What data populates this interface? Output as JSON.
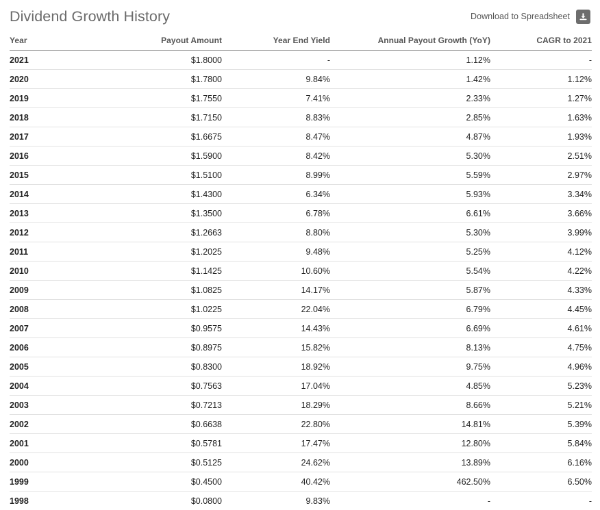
{
  "header": {
    "title": "Dividend Growth History",
    "download_label": "Download to Spreadsheet",
    "download_icon": "download-icon"
  },
  "table": {
    "columns": [
      "Year",
      "Payout Amount",
      "Year End Yield",
      "Annual Payout Growth (YoY)",
      "CAGR to 2021"
    ],
    "rows": [
      {
        "year": "2021",
        "payout": "$1.8000",
        "yield": "-",
        "growth": "1.12%",
        "cagr": "-"
      },
      {
        "year": "2020",
        "payout": "$1.7800",
        "yield": "9.84%",
        "growth": "1.42%",
        "cagr": "1.12%"
      },
      {
        "year": "2019",
        "payout": "$1.7550",
        "yield": "7.41%",
        "growth": "2.33%",
        "cagr": "1.27%"
      },
      {
        "year": "2018",
        "payout": "$1.7150",
        "yield": "8.83%",
        "growth": "2.85%",
        "cagr": "1.63%"
      },
      {
        "year": "2017",
        "payout": "$1.6675",
        "yield": "8.47%",
        "growth": "4.87%",
        "cagr": "1.93%"
      },
      {
        "year": "2016",
        "payout": "$1.5900",
        "yield": "8.42%",
        "growth": "5.30%",
        "cagr": "2.51%"
      },
      {
        "year": "2015",
        "payout": "$1.5100",
        "yield": "8.99%",
        "growth": "5.59%",
        "cagr": "2.97%"
      },
      {
        "year": "2014",
        "payout": "$1.4300",
        "yield": "6.34%",
        "growth": "5.93%",
        "cagr": "3.34%"
      },
      {
        "year": "2013",
        "payout": "$1.3500",
        "yield": "6.78%",
        "growth": "6.61%",
        "cagr": "3.66%"
      },
      {
        "year": "2012",
        "payout": "$1.2663",
        "yield": "8.80%",
        "growth": "5.30%",
        "cagr": "3.99%"
      },
      {
        "year": "2011",
        "payout": "$1.2025",
        "yield": "9.48%",
        "growth": "5.25%",
        "cagr": "4.12%"
      },
      {
        "year": "2010",
        "payout": "$1.1425",
        "yield": "10.60%",
        "growth": "5.54%",
        "cagr": "4.22%"
      },
      {
        "year": "2009",
        "payout": "$1.0825",
        "yield": "14.17%",
        "growth": "5.87%",
        "cagr": "4.33%"
      },
      {
        "year": "2008",
        "payout": "$1.0225",
        "yield": "22.04%",
        "growth": "6.79%",
        "cagr": "4.45%"
      },
      {
        "year": "2007",
        "payout": "$0.9575",
        "yield": "14.43%",
        "growth": "6.69%",
        "cagr": "4.61%"
      },
      {
        "year": "2006",
        "payout": "$0.8975",
        "yield": "15.82%",
        "growth": "8.13%",
        "cagr": "4.75%"
      },
      {
        "year": "2005",
        "payout": "$0.8300",
        "yield": "18.92%",
        "growth": "9.75%",
        "cagr": "4.96%"
      },
      {
        "year": "2004",
        "payout": "$0.7563",
        "yield": "17.04%",
        "growth": "4.85%",
        "cagr": "5.23%"
      },
      {
        "year": "2003",
        "payout": "$0.7213",
        "yield": "18.29%",
        "growth": "8.66%",
        "cagr": "5.21%"
      },
      {
        "year": "2002",
        "payout": "$0.6638",
        "yield": "22.80%",
        "growth": "14.81%",
        "cagr": "5.39%"
      },
      {
        "year": "2001",
        "payout": "$0.5781",
        "yield": "17.47%",
        "growth": "12.80%",
        "cagr": "5.84%"
      },
      {
        "year": "2000",
        "payout": "$0.5125",
        "yield": "24.62%",
        "growth": "13.89%",
        "cagr": "6.16%"
      },
      {
        "year": "1999",
        "payout": "$0.4500",
        "yield": "40.42%",
        "growth": "462.50%",
        "cagr": "6.50%"
      },
      {
        "year": "1998",
        "payout": "$0.0800",
        "yield": "9.83%",
        "growth": "-",
        "cagr": "-"
      }
    ]
  },
  "colors": {
    "title": "#6b6b6b",
    "header_text": "#555555",
    "body_text": "#222222",
    "header_rule": "#9a9a9a",
    "row_rule": "#e2e2e2",
    "icon_bg": "#6d6d6d"
  }
}
